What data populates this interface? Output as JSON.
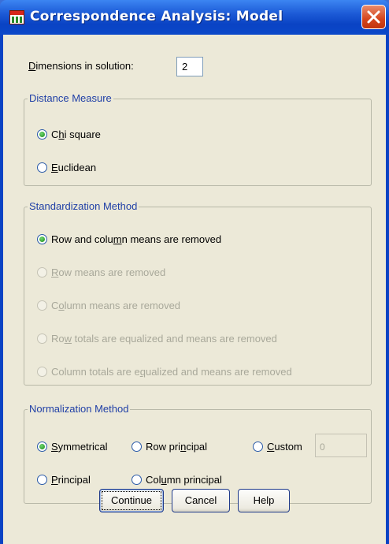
{
  "window": {
    "title": "Correspondence Analysis: Model"
  },
  "dimensions": {
    "label_pre": "",
    "label_mnemonic": "D",
    "label_rest": "imensions in solution:",
    "value": "2"
  },
  "distance": {
    "legend": "Distance Measure",
    "options": [
      {
        "pre": "C",
        "m": "h",
        "post": "i square",
        "selected": true,
        "enabled": true
      },
      {
        "pre": "",
        "m": "E",
        "post": "uclidean",
        "selected": false,
        "enabled": true
      }
    ]
  },
  "standardization": {
    "legend": "Standardization Method",
    "options": [
      {
        "pre": "Row and colu",
        "m": "m",
        "post": "n means are removed",
        "selected": true,
        "enabled": true
      },
      {
        "pre": "",
        "m": "R",
        "post": "ow means are removed",
        "selected": false,
        "enabled": false
      },
      {
        "pre": "C",
        "m": "o",
        "post": "lumn means are removed",
        "selected": false,
        "enabled": false
      },
      {
        "pre": "Ro",
        "m": "w",
        "post": " totals are equalized and means are removed",
        "selected": false,
        "enabled": false
      },
      {
        "pre": "Column totals are e",
        "m": "q",
        "post": "ualized and means are removed",
        "selected": false,
        "enabled": false
      }
    ]
  },
  "normalization": {
    "legend": "Normalization Method",
    "symmetrical": {
      "pre": "",
      "m": "S",
      "post": "ymmetrical",
      "selected": true
    },
    "row_principal": {
      "pre": "Row pri",
      "m": "n",
      "post": "cipal",
      "selected": false
    },
    "custom": {
      "pre": "",
      "m": "C",
      "post": "ustom",
      "selected": false,
      "value": "0"
    },
    "principal": {
      "pre": "",
      "m": "P",
      "post": "rincipal",
      "selected": false
    },
    "column_principal": {
      "pre": "Col",
      "m": "u",
      "post": "mn principal",
      "selected": false
    }
  },
  "buttons": {
    "continue": "Continue",
    "cancel": "Cancel",
    "help": "Help"
  }
}
